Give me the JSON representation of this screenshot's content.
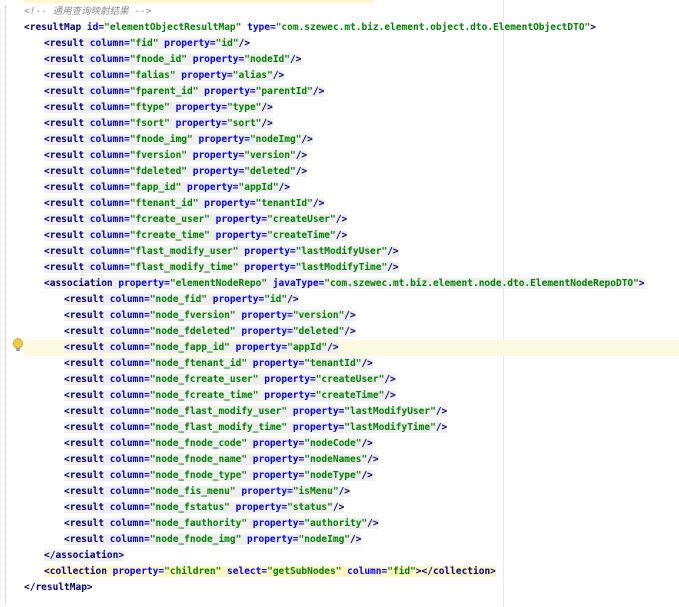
{
  "comment": "<!-- 通用查询映射结果 -->",
  "result_map": {
    "id": "elementObjectResultMap",
    "type": "com.szewec.mt.biz.element.object.dto.ElementObjectDTO"
  },
  "results": [
    {
      "column": "fid",
      "property": "id"
    },
    {
      "column": "fnode_id",
      "property": "nodeId"
    },
    {
      "column": "falias",
      "property": "alias"
    },
    {
      "column": "fparent_id",
      "property": "parentId"
    },
    {
      "column": "ftype",
      "property": "type"
    },
    {
      "column": "fsort",
      "property": "sort"
    },
    {
      "column": "fnode_img",
      "property": "nodeImg"
    },
    {
      "column": "fversion",
      "property": "version"
    },
    {
      "column": "fdeleted",
      "property": "deleted"
    },
    {
      "column": "fapp_id",
      "property": "appId"
    },
    {
      "column": "ftenant_id",
      "property": "tenantId"
    },
    {
      "column": "fcreate_user",
      "property": "createUser"
    },
    {
      "column": "fcreate_time",
      "property": "createTime"
    },
    {
      "column": "flast_modify_user",
      "property": "lastModifyUser"
    },
    {
      "column": "flast_modify_time",
      "property": "lastModifyTime"
    }
  ],
  "association": {
    "property": "elementNodeRepo",
    "javaType": "com.szewec.mt.biz.element.node.dto.ElementNodeRepoDTO",
    "results": [
      {
        "column": "node_fid",
        "property": "id"
      },
      {
        "column": "node_fversion",
        "property": "version"
      },
      {
        "column": "node_fdeleted",
        "property": "deleted"
      },
      {
        "column": "node_fapp_id",
        "property": "appId"
      },
      {
        "column": "node_ftenant_id",
        "property": "tenantId"
      },
      {
        "column": "node_fcreate_user",
        "property": "createUser"
      },
      {
        "column": "node_fcreate_time",
        "property": "createTime"
      },
      {
        "column": "node_flast_modify_user",
        "property": "lastModifyUser"
      },
      {
        "column": "node_flast_modify_time",
        "property": "lastModifyTime"
      },
      {
        "column": "node_fnode_code",
        "property": "nodeCode"
      },
      {
        "column": "node_fnode_name",
        "property": "nodeNames"
      },
      {
        "column": "node_fnode_type",
        "property": "nodeType"
      },
      {
        "column": "node_fis_menu",
        "property": "isMenu"
      },
      {
        "column": "node_fstatus",
        "property": "status"
      },
      {
        "column": "node_fauthority",
        "property": "authority"
      },
      {
        "column": "node_fnode_img",
        "property": "nodeImg"
      }
    ]
  },
  "collection": {
    "property": "children",
    "select": "getSubNodes",
    "column": "fid"
  },
  "colors": {
    "tag": "#000080",
    "attr": "#0000ff",
    "value": "#008000",
    "comment": "#8c8c8c",
    "caret_row": "#fefae0"
  },
  "icons": {
    "gutter_hint": "lightbulb-icon"
  }
}
